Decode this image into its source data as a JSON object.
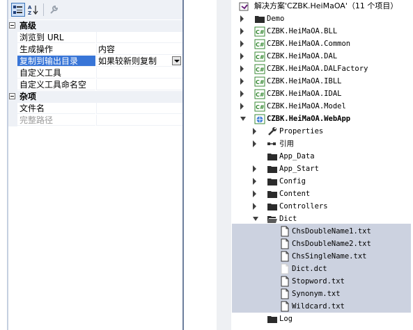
{
  "properties": {
    "categories": [
      {
        "label": "高级",
        "rows": [
          {
            "name": "浏览到 URL",
            "value": ""
          },
          {
            "name": "生成操作",
            "value": "内容"
          },
          {
            "name": "复制到输出目录",
            "value": "如果较新则复制",
            "selected": true
          },
          {
            "name": "自定义工具",
            "value": ""
          },
          {
            "name": "自定义工具命名空",
            "value": ""
          }
        ]
      },
      {
        "label": "杂项",
        "rows": [
          {
            "name": "文件名",
            "value": ""
          },
          {
            "name": "完整路径",
            "value": "",
            "dimmed": true
          }
        ]
      }
    ]
  },
  "solution": {
    "title": "解决方案'CZBK.HeiMaOA'（11 个项目）",
    "items": [
      {
        "label": "Demo",
        "level": 0,
        "expander": "collapsed",
        "icon": "folder"
      },
      {
        "label": "CZBK.HeiMaOA.BLL",
        "level": 0,
        "expander": "collapsed",
        "icon": "csharp-project"
      },
      {
        "label": "CZBK.HeiMaOA.Common",
        "level": 0,
        "expander": "collapsed",
        "icon": "csharp-project"
      },
      {
        "label": "CZBK.HeiMaOA.DAL",
        "level": 0,
        "expander": "collapsed",
        "icon": "csharp-project"
      },
      {
        "label": "CZBK.HeiMaOA.DALFactory",
        "level": 0,
        "expander": "collapsed",
        "icon": "csharp-project"
      },
      {
        "label": "CZBK.HeiMaOA.IBLL",
        "level": 0,
        "expander": "collapsed",
        "icon": "csharp-project"
      },
      {
        "label": "CZBK.HeiMaOA.IDAL",
        "level": 0,
        "expander": "collapsed",
        "icon": "csharp-project"
      },
      {
        "label": "CZBK.HeiMaOA.Model",
        "level": 0,
        "expander": "collapsed",
        "icon": "csharp-project"
      },
      {
        "label": "CZBK.HeiMaOA.WebApp",
        "level": 0,
        "expander": "expanded",
        "icon": "web-project",
        "bold": true
      },
      {
        "label": "Properties",
        "level": 1,
        "expander": "collapsed",
        "icon": "wrench"
      },
      {
        "label": "引用",
        "level": 1,
        "expander": "collapsed",
        "icon": "references"
      },
      {
        "label": "App_Data",
        "level": 1,
        "expander": "none",
        "icon": "folder"
      },
      {
        "label": "App_Start",
        "level": 1,
        "expander": "collapsed",
        "icon": "folder"
      },
      {
        "label": "Config",
        "level": 1,
        "expander": "collapsed",
        "icon": "folder"
      },
      {
        "label": "Content",
        "level": 1,
        "expander": "collapsed",
        "icon": "folder"
      },
      {
        "label": "Controllers",
        "level": 1,
        "expander": "collapsed",
        "icon": "folder"
      },
      {
        "label": "Dict",
        "level": 1,
        "expander": "expanded",
        "icon": "folder-open"
      },
      {
        "label": "ChsDoubleName1.txt",
        "level": 2,
        "expander": "none",
        "icon": "text-file",
        "selected": true
      },
      {
        "label": "ChsDoubleName2.txt",
        "level": 2,
        "expander": "none",
        "icon": "text-file",
        "selected": true
      },
      {
        "label": "ChsSingleName.txt",
        "level": 2,
        "expander": "none",
        "icon": "text-file",
        "selected": true
      },
      {
        "label": "Dict.dct",
        "level": 2,
        "expander": "none",
        "icon": "blank-file",
        "selected": true
      },
      {
        "label": "Stopword.txt",
        "level": 2,
        "expander": "none",
        "icon": "text-file",
        "selected": true
      },
      {
        "label": "Synonym.txt",
        "level": 2,
        "expander": "none",
        "icon": "text-file",
        "selected": true
      },
      {
        "label": "Wildcard.txt",
        "level": 2,
        "expander": "none",
        "icon": "text-file",
        "selected": true
      },
      {
        "label": "Log",
        "level": 1,
        "expander": "none",
        "icon": "folder"
      }
    ]
  }
}
